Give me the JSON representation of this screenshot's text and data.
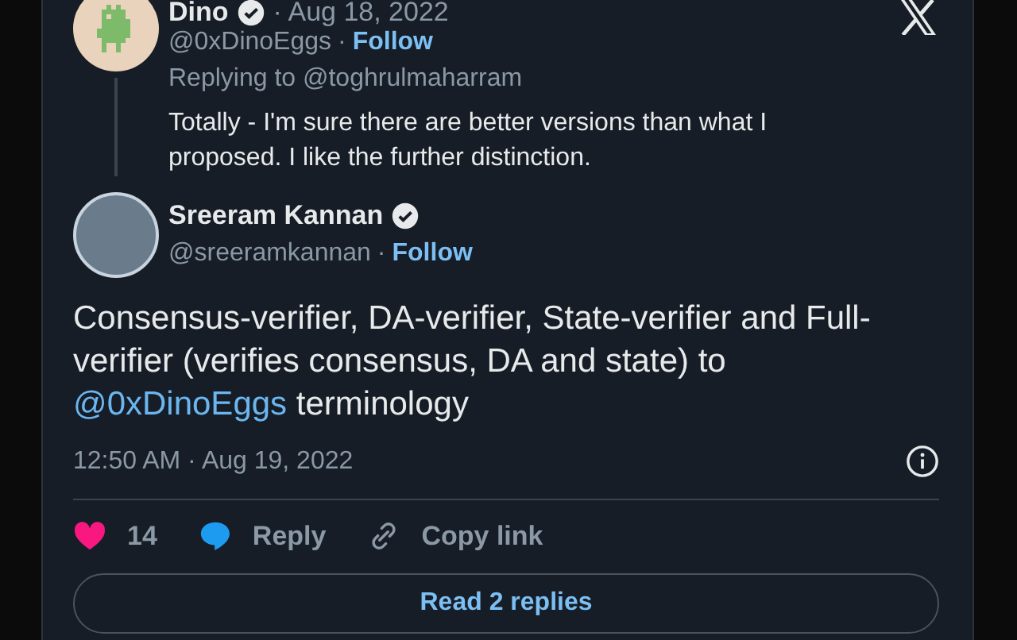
{
  "logo": {
    "kind": "x"
  },
  "reply_tweet": {
    "name": "Dino",
    "verified": true,
    "date": "· Aug 18, 2022",
    "handle": "@0xDinoEggs",
    "dot": "·",
    "follow": "Follow",
    "replying_to": "Replying to @toghrulmaharram",
    "text": [
      {
        "kind": "plain",
        "text": "Totally - I'm sure there are better versions than what I proposed. I like the further distinction."
      }
    ]
  },
  "main_tweet": {
    "name": "Sreeram Kannan",
    "verified": true,
    "handle": "@sreeramkannan",
    "dot": "·",
    "follow": "Follow",
    "text": [
      {
        "kind": "plain",
        "text": "Consensus-verifier, DA-verifier, State-verifier and Full-verifier (verifies consensus, DA and state) to "
      },
      {
        "kind": "mention",
        "text": "@0xDinoEggs"
      },
      {
        "kind": "plain",
        "text": " terminology"
      }
    ],
    "timestamp": "12:50 AM · Aug 19, 2022",
    "actions": [
      {
        "kind": "like",
        "label": "14"
      },
      {
        "kind": "reply",
        "label": "Reply"
      },
      {
        "kind": "copy",
        "label": "Copy link"
      }
    ],
    "replies_button": "Read 2 replies"
  }
}
